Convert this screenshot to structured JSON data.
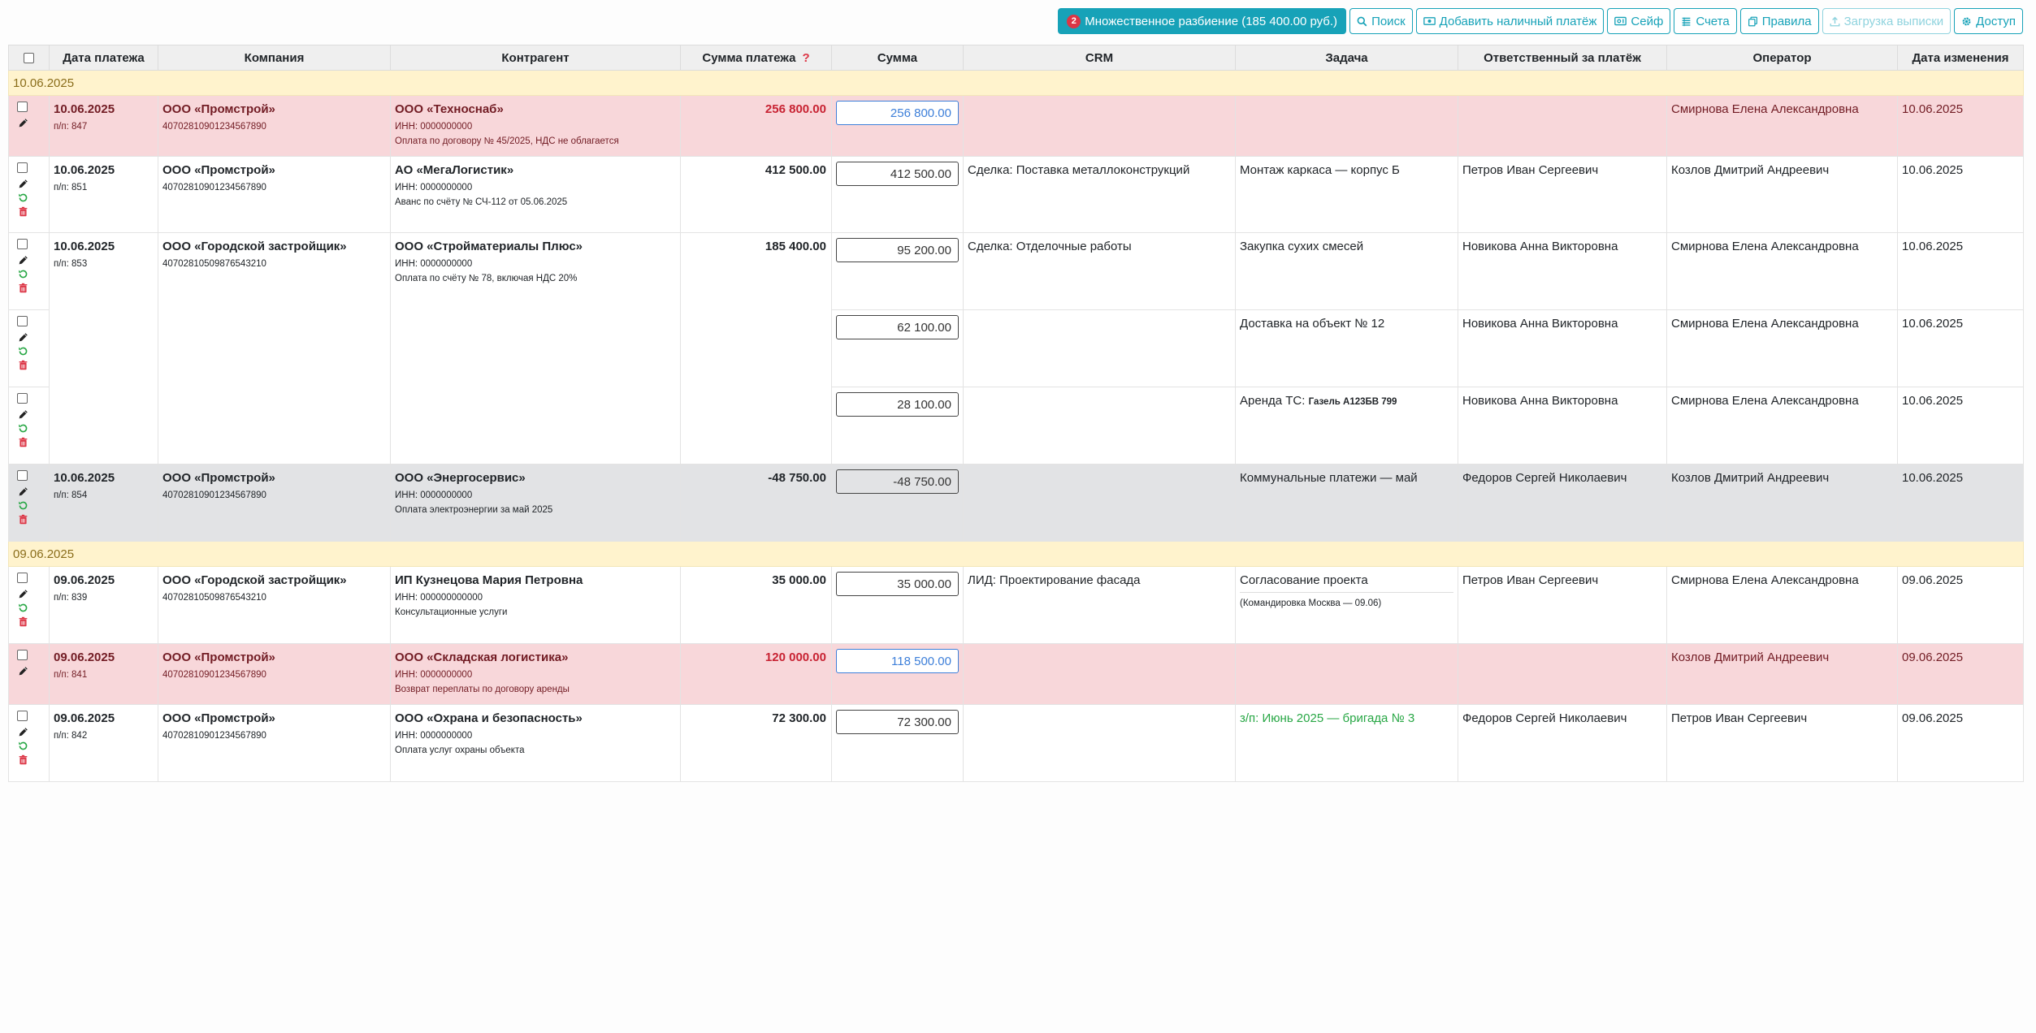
{
  "toolbar": {
    "split_badge": "2",
    "split_label": "Множественное разбиение (185 400.00 руб.)",
    "search_label": "Поиск",
    "add_cash_label": "Добавить наличный платёж",
    "safe_label": "Сейф",
    "accounts_label": "Счета",
    "rules_label": "Правила",
    "upload_label": "Загрузка выписки",
    "access_label": "Доступ"
  },
  "columns": {
    "date": "Дата платежа",
    "company": "Компания",
    "counterparty": "Контрагент",
    "payment_sum": "Сумма платежа",
    "payment_sum_help": "?",
    "sum": "Сумма",
    "crm": "CRM",
    "task": "Задача",
    "responsible": "Ответственный за платёж",
    "operator": "Оператор",
    "changed": "Дата изменения"
  },
  "groups": [
    "10.06.2025",
    "09.06.2025"
  ],
  "rows": [
    {
      "date": "10.06.2025",
      "num": "п/п: 847",
      "company": "ООО «Промстрой»",
      "account": "40702810901234567890",
      "cp": "ООО «Техноснаб»",
      "inn": "ИНН: 0000000000",
      "purpose": "Оплата по договору № 45/2025, НДС не облагается",
      "amount": "256 800.00",
      "sum": "256 800.00",
      "crm": "",
      "task": "",
      "responsible": "",
      "operator": "Смирнова Елена Александровна",
      "changed": "10.06.2025"
    },
    {
      "date": "10.06.2025",
      "num": "п/п: 851",
      "company": "ООО «Промстрой»",
      "account": "40702810901234567890",
      "cp": "АО «МегаЛогистик»",
      "inn": "ИНН: 0000000000",
      "purpose": "Аванс по счёту № СЧ-112 от 05.06.2025",
      "amount": "412 500.00",
      "sum": "412 500.00",
      "crm": "Сделка: Поставка металлоконструкций",
      "task": "Монтаж каркаса — корпус Б",
      "responsible": "Петров Иван Сергеевич",
      "operator": "Козлов Дмитрий Андреевич",
      "changed": "10.06.2025"
    },
    {
      "date": "10.06.2025",
      "num": "п/п: 853",
      "company": "ООО «Городской застройщик»",
      "account": "40702810509876543210",
      "cp": "ООО «Стройматериалы Плюс»",
      "inn": "ИНН: 0000000000",
      "purpose": "Оплата по счёту № 78, включая НДС 20%",
      "amount": "185 400.00",
      "splits": [
        {
          "sum": "95 200.00",
          "crm": "Сделка: Отделочные работы",
          "task": "Закупка сухих смесей",
          "responsible": "Новикова Анна Викторовна",
          "operator": "Смирнова Елена Александровна",
          "changed": "10.06.2025"
        },
        {
          "sum": "62 100.00",
          "crm": "",
          "task": "Доставка на объект № 12",
          "responsible": "Новикова Анна Викторовна",
          "operator": "Смирнова Елена Александровна",
          "changed": "10.06.2025"
        },
        {
          "sum": "28 100.00",
          "crm": "",
          "task": "Аренда ТС:",
          "task_extra": "Газель А123БВ 799",
          "responsible": "Новикова Анна Викторовна",
          "operator": "Смирнова Елена Александровна",
          "changed": "10.06.2025"
        }
      ]
    },
    {
      "date": "10.06.2025",
      "num": "п/п: 854",
      "company": "ООО «Промстрой»",
      "account": "40702810901234567890",
      "cp": "ООО «Энергосервис»",
      "inn": "ИНН: 0000000000",
      "purpose": "Оплата электроэнергии за май 2025",
      "amount": "-48 750.00",
      "sum": "-48 750.00",
      "crm": "",
      "task": "Коммунальные платежи — май",
      "responsible": "Федоров Сергей Николаевич",
      "operator": "Козлов Дмитрий Андреевич",
      "changed": "10.06.2025"
    },
    {
      "date": "09.06.2025",
      "num": "п/п: 839",
      "company": "ООО «Городской застройщик»",
      "account": "40702810509876543210",
      "cp": "ИП Кузнецова Мария Петровна",
      "inn": "ИНН: 000000000000",
      "purpose": "Консультационные услуги",
      "amount": "35 000.00",
      "sum": "35 000.00",
      "crm": "ЛИД: Проектирование фасада",
      "task": "Согласование проекта",
      "task_note": "(Командировка Москва — 09.06)",
      "responsible": "Петров Иван Сергеевич",
      "operator": "Смирнова Елена Александровна",
      "changed": "09.06.2025"
    },
    {
      "date": "09.06.2025",
      "num": "п/п: 841",
      "company": "ООО «Промстрой»",
      "account": "40702810901234567890",
      "cp": "ООО «Складская логистика»",
      "inn": "ИНН: 0000000000",
      "purpose": "Возврат переплаты по договору аренды",
      "amount": "120 000.00",
      "sum": "118 500.00",
      "crm": "",
      "task": "",
      "responsible": "",
      "operator": "Козлов Дмитрий Андреевич",
      "changed": "09.06.2025"
    },
    {
      "date": "09.06.2025",
      "num": "п/п: 842",
      "company": "ООО «Промстрой»",
      "account": "40702810901234567890",
      "cp": "ООО «Охрана и безопасность»",
      "inn": "ИНН: 0000000000",
      "purpose": "Оплата услуг охраны объекта",
      "amount": "72 300.00",
      "sum": "72 300.00",
      "crm": "",
      "task": "з/п: Июнь 2025 — бригада № 3",
      "responsible": "Федоров Сергей Николаевич",
      "operator": "Петров Иван Сергеевич",
      "changed": "09.06.2025"
    }
  ],
  "colors": {
    "accent": "#17a2b8",
    "danger_row": "#f8d7da",
    "gray_row": "#e2e3e5",
    "group_row": "#fff3cd",
    "edit_icon": "#222222",
    "restore_icon": "#28a745",
    "delete_icon": "#dc3545"
  },
  "icons": [
    "search-icon",
    "cash-icon",
    "safe-icon",
    "list-icon",
    "copy-icon",
    "upload-icon",
    "gear-icon",
    "pencil-icon",
    "restore-icon",
    "trash-icon"
  ]
}
